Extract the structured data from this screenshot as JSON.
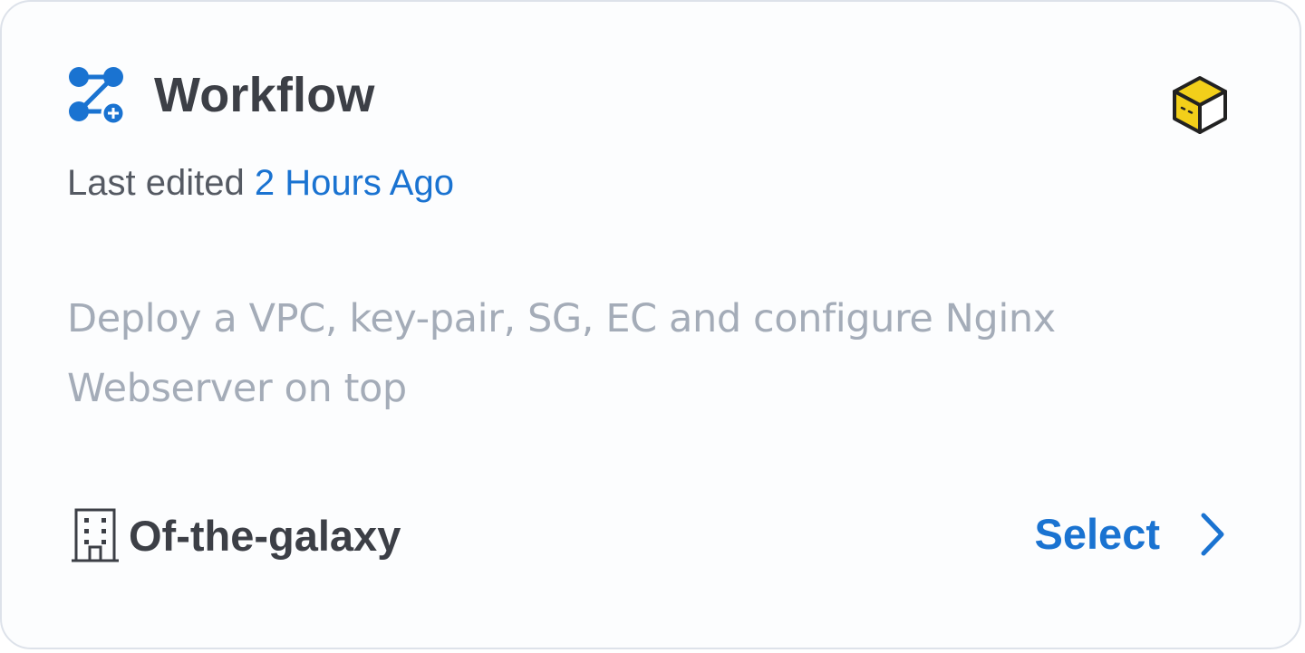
{
  "card": {
    "title": "Workflow",
    "title_icon": "workflow-icon",
    "badge_icon": "cube-icon",
    "last_edited_prefix": "Last edited",
    "last_edited_time": "2 Hours Ago",
    "description": "Deploy a VPC, key-pair, SG, EC and configure Nginx Webserver on top",
    "organization": {
      "icon": "building-icon",
      "name": "Of-the-galaxy"
    },
    "action": {
      "label": "Select",
      "icon": "chevron-right-icon"
    }
  },
  "colors": {
    "accent": "#1a73d1",
    "title_text": "#3c3f46",
    "muted_text": "#a4acb8",
    "secondary_text": "#555a63",
    "border": "#dde2ea",
    "badge_yellow": "#f2cf1a"
  }
}
